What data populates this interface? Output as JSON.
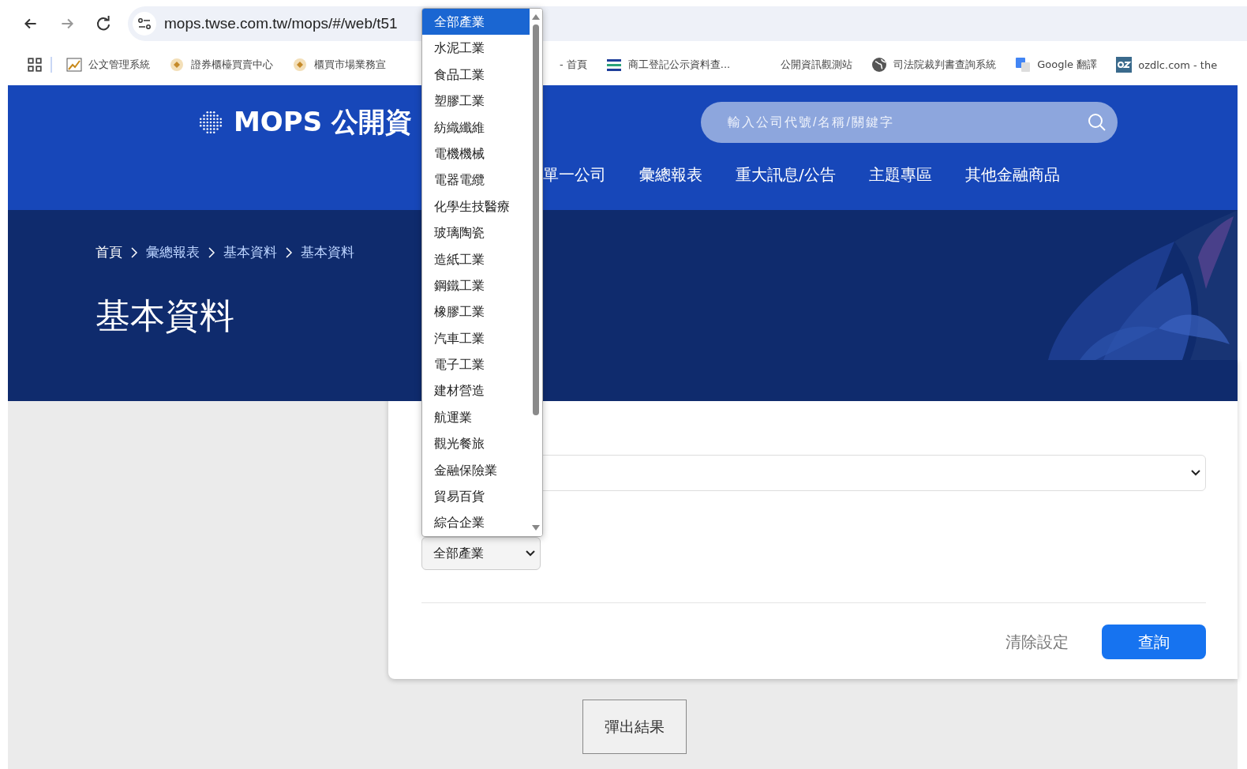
{
  "browser": {
    "address": "mops.twse.com.tw/mops/#/web/t51",
    "bookmarks": [
      {
        "label": "公文管理系統"
      },
      {
        "label": "證券櫃檯買賣中心"
      },
      {
        "label": "櫃買市場業務宣"
      },
      {
        "label": "- 首頁"
      },
      {
        "label": "商工登記公示資料查..."
      },
      {
        "label": "公開資訊觀測站"
      },
      {
        "label": "司法院裁判書查詢系統"
      },
      {
        "label": "Google 翻譯"
      },
      {
        "label": "ozdlc.com - the"
      }
    ]
  },
  "header": {
    "logo_text": "MOPS 公開資",
    "search_placeholder": "輸入公司代號/名稱/關鍵字",
    "nav": [
      "單一公司",
      "彙總報表",
      "重大訊息/公告",
      "主題專區",
      "其他金融商品"
    ]
  },
  "breadcrumb": [
    "首頁",
    "彙總報表",
    "基本資料",
    "基本資料"
  ],
  "page_title": "基本資料",
  "industry_select": {
    "value": "全部產業",
    "expanded": true,
    "options": [
      {
        "label": "全部產業",
        "selected": true
      },
      {
        "label": "水泥工業",
        "selected": false
      },
      {
        "label": "食品工業",
        "selected": false
      },
      {
        "label": "塑膠工業",
        "selected": false
      },
      {
        "label": "紡織纖維",
        "selected": false
      },
      {
        "label": "電機機械",
        "selected": false
      },
      {
        "label": "電器電纜",
        "selected": false
      },
      {
        "label": "化學生技醫療",
        "selected": false
      },
      {
        "label": "玻璃陶瓷",
        "selected": false
      },
      {
        "label": "造紙工業",
        "selected": false
      },
      {
        "label": "鋼鐵工業",
        "selected": false
      },
      {
        "label": "橡膠工業",
        "selected": false
      },
      {
        "label": "汽車工業",
        "selected": false
      },
      {
        "label": "電子工業",
        "selected": false
      },
      {
        "label": "建材營造",
        "selected": false
      },
      {
        "label": "航運業",
        "selected": false
      },
      {
        "label": "觀光餐旅",
        "selected": false
      },
      {
        "label": "金融保險業",
        "selected": false
      },
      {
        "label": "貿易百貨",
        "selected": false
      },
      {
        "label": "綜合企業",
        "selected": false
      }
    ]
  },
  "buttons": {
    "clear": "清除設定",
    "query": "查詢",
    "popup": "彈出結果"
  }
}
